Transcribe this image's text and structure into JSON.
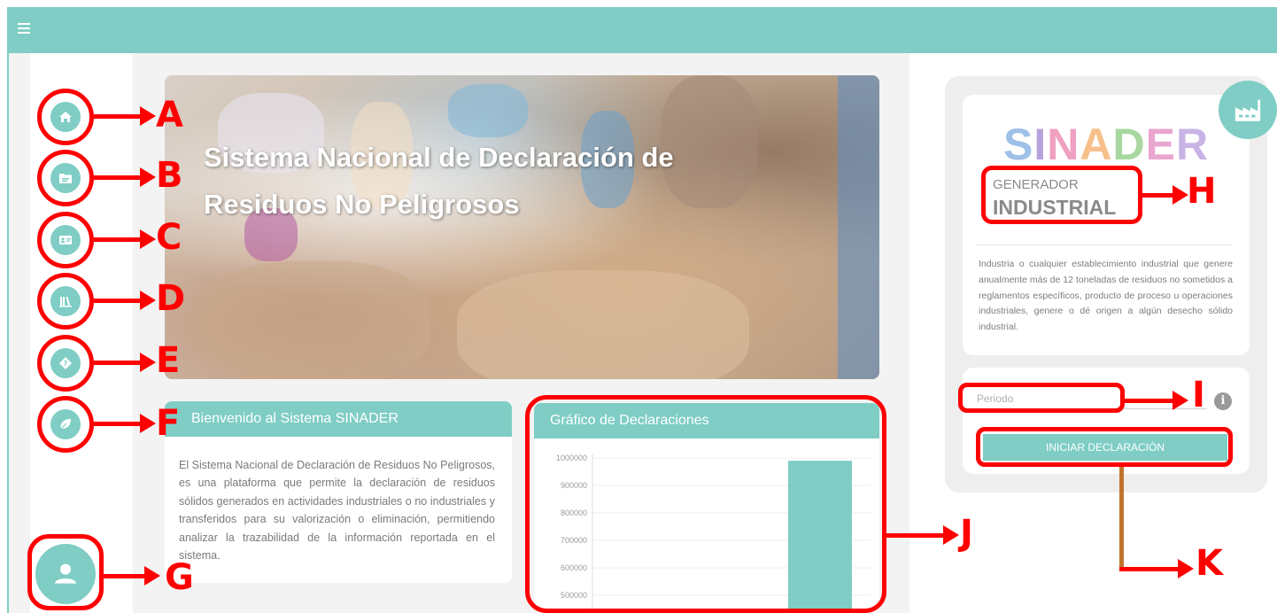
{
  "colors": {
    "accent": "#7fcdc5",
    "annotation": "#ff0000",
    "connector": "#c0742d"
  },
  "topbar": {
    "menu_icon": "hamburger-icon"
  },
  "sidebar": {
    "items": [
      {
        "icon": "home-icon",
        "callout": "A"
      },
      {
        "icon": "folder-icon",
        "callout": "B"
      },
      {
        "icon": "id-card-icon",
        "callout": "C"
      },
      {
        "icon": "library-icon",
        "callout": "D"
      },
      {
        "icon": "help-diamond-icon",
        "callout": "E"
      },
      {
        "icon": "leaf-icon",
        "callout": "F"
      }
    ],
    "user": {
      "icon": "user-icon",
      "callout": "G"
    }
  },
  "hero": {
    "title": "Sistema Nacional de Declaración de Residuos No Peligrosos"
  },
  "welcome": {
    "title": "Bienvenido al Sistema SINADER",
    "body": "El Sistema Nacional de Declaración de Residuos No Peligrosos, es una plataforma que permite la declaración de residuos sólidos generados en actividades industriales o no industriales y transferidos para su valorización o eliminación, permitiendo analizar la trazabilidad de la información reportada en el sistema."
  },
  "chart": {
    "title": "Gráfico de Declaraciones",
    "callout": "J"
  },
  "chart_data": {
    "type": "bar",
    "title": "Gráfico de Declaraciones",
    "y_ticks": [
      1000000,
      900000,
      800000,
      700000,
      600000,
      500000
    ],
    "ylim": [
      500000,
      1000000
    ],
    "grid": true,
    "values": [
      990000
    ],
    "colors": [
      "#7fcdc5"
    ]
  },
  "info": {
    "brand": "SINADER",
    "brand_colors": [
      "#9fc0e8",
      "#b5a3dc",
      "#f0a0c0",
      "#f7c08a",
      "#a8d7a0",
      "#e9a7cf",
      "#c9b3e6"
    ],
    "factory_icon": "factory-icon",
    "type_label": "GENERADOR",
    "type_value": "INDUSTRIAL",
    "type_callout": "H",
    "description": "Industria o cualquier establecimiento industrial que genere anualmente más de 12 toneladas de residuos no sometidos a reglamentos específicos, producto de proceso u operaciones industriales, genere o dé origen a algún desecho sólido industrial."
  },
  "form": {
    "period_placeholder": "Periodo",
    "period_value": "",
    "period_callout": "I",
    "info_icon": "info-icon",
    "info_glyph": "i",
    "start_label": "INICIAR DECLARACIÓN",
    "start_callout": "K"
  }
}
